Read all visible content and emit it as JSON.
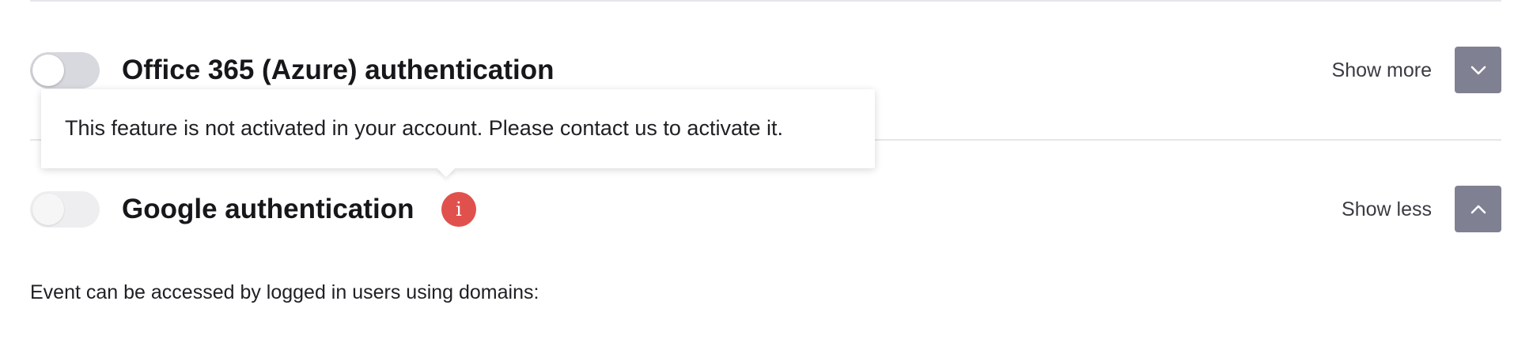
{
  "office365": {
    "title": "Office 365 (Azure) authentication",
    "enabled": false,
    "show_label": "Show more",
    "chevron_icon": "chevron-down-icon"
  },
  "google": {
    "title": "Google authentication",
    "enabled": false,
    "disabled": true,
    "info_badge": "i",
    "show_label": "Show less",
    "chevron_icon": "chevron-up-icon"
  },
  "tooltip": {
    "text": "This feature is not activated in your account. Please contact us to activate it."
  },
  "domains": {
    "label": "Event can be accessed by logged in users using domains:"
  },
  "colors": {
    "button_bg": "#7f8192",
    "info_badge_bg": "#e0514e",
    "toggle_off": "#d8d9de",
    "divider": "#e6e6ea"
  }
}
